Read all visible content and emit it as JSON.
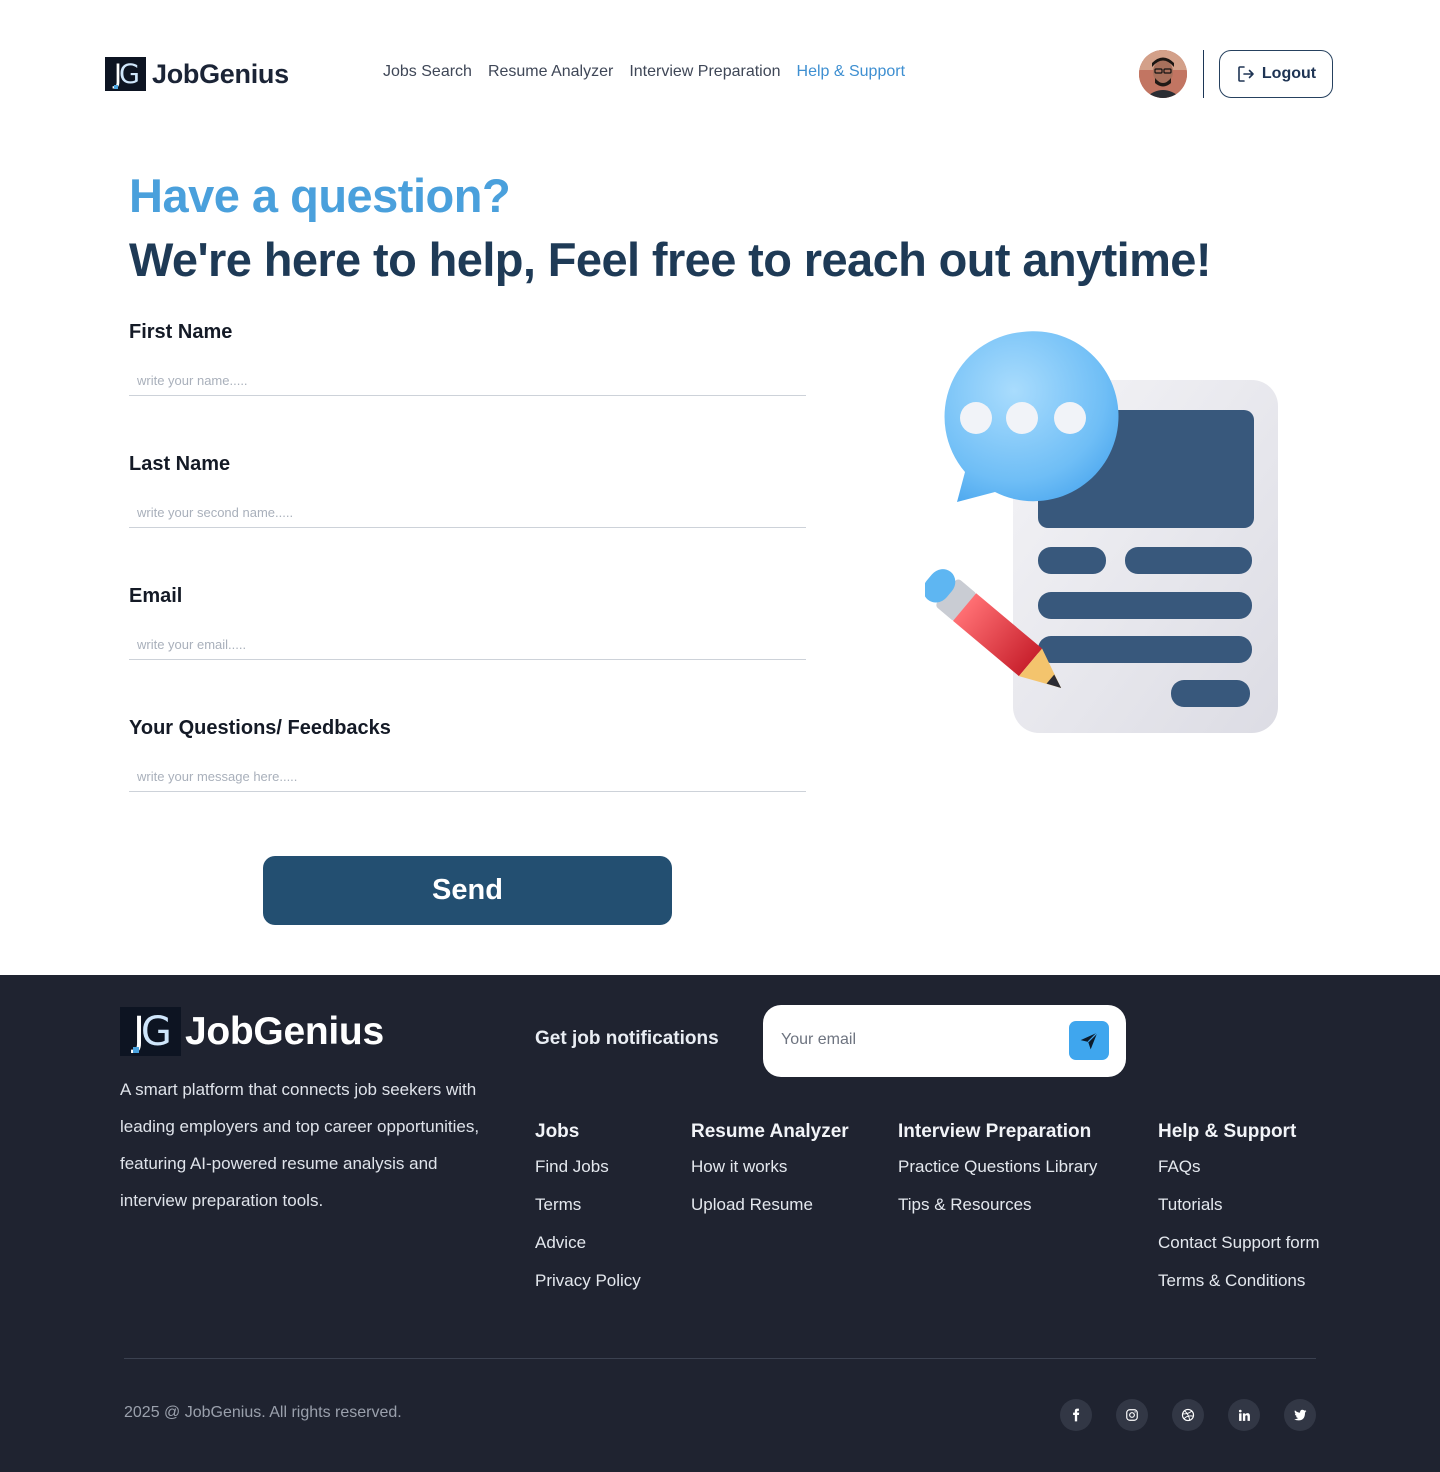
{
  "header": {
    "logo_mark_left": "J",
    "logo_mark_right": "G",
    "logo_text": "JobGenius",
    "nav": [
      {
        "label": "Jobs Search",
        "active": false
      },
      {
        "label": "Resume Analyzer",
        "active": false
      },
      {
        "label": "Interview Preparation",
        "active": false
      },
      {
        "label": "Help & Support",
        "active": true
      }
    ],
    "avatar_icon": "user-avatar",
    "logout_label": "Logout",
    "logout_icon": "logout-icon"
  },
  "hero": {
    "question": "Have a question?",
    "subtitle": "We're here to help, Feel free to reach out anytime!"
  },
  "form": {
    "fields": [
      {
        "label": "First Name",
        "placeholder": "write your name....."
      },
      {
        "label": "Last Name",
        "placeholder": "write your second name....."
      },
      {
        "label": "Email",
        "placeholder": "write your email....."
      },
      {
        "label": "Your Questions/ Feedbacks",
        "placeholder": "write your message here....."
      }
    ],
    "send_label": "Send"
  },
  "footer": {
    "logo_text": "JobGenius",
    "description": "A smart platform that connects job seekers with leading employers and top career opportunities, featuring AI-powered resume analysis and interview preparation tools.",
    "notify_label": "Get job notifications",
    "notify_placeholder": "Your email",
    "columns": [
      {
        "title": "Jobs",
        "links": [
          "Find Jobs",
          "Terms",
          "Advice",
          "Privacy Policy"
        ]
      },
      {
        "title": "Resume Analyzer",
        "links": [
          "How it works",
          "Upload Resume"
        ]
      },
      {
        "title": "Interview Preparation",
        "links": [
          "Practice Questions Library",
          "Tips & Resources"
        ]
      },
      {
        "title": "Help & Support",
        "links": [
          "FAQs",
          "Tutorials",
          "Contact Support form",
          "Terms & Conditions"
        ]
      }
    ],
    "copyright": "2025 @ JobGenius. All rights reserved.",
    "socials": [
      "facebook-icon",
      "instagram-icon",
      "dribbble-icon",
      "linkedin-icon",
      "twitter-icon"
    ]
  },
  "colors": {
    "accent": "#4aa0dc",
    "heading_dark": "#1e3a56",
    "button": "#234f71",
    "footer_bg": "#1f2330"
  }
}
